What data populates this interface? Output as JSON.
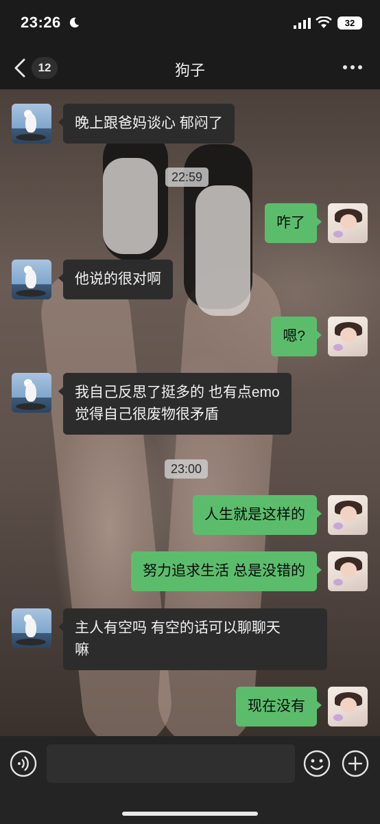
{
  "status_bar": {
    "time": "23:26",
    "battery": "32",
    "icons": [
      "moon-icon",
      "cellular-signal-icon",
      "wifi-icon",
      "battery-icon"
    ]
  },
  "nav": {
    "title": "狗子",
    "unread_count": "12",
    "icons": [
      "chevron-left-icon",
      "more-icon"
    ]
  },
  "messages": [
    {
      "type": "text",
      "from": "contact",
      "text": "晚上跟爸妈谈心 郁闷了"
    },
    {
      "type": "time",
      "text": "22:59"
    },
    {
      "type": "text",
      "from": "me",
      "text": "咋了"
    },
    {
      "type": "text",
      "from": "contact",
      "text": "他说的很对啊"
    },
    {
      "type": "text",
      "from": "me",
      "text": "嗯?"
    },
    {
      "type": "text",
      "from": "contact",
      "text": "我自己反思了挺多的 也有点emo\n觉得自己很废物很矛盾"
    },
    {
      "type": "time",
      "text": "23:00"
    },
    {
      "type": "text",
      "from": "me",
      "text": "人生就是这样的"
    },
    {
      "type": "text",
      "from": "me",
      "text": "努力追求生活 总是没错的"
    },
    {
      "type": "text",
      "from": "contact",
      "text": "主人有空吗 有空的话可以聊聊天\n嘛"
    },
    {
      "type": "text",
      "from": "me",
      "text": "现在没有"
    }
  ],
  "input_bar": {
    "placeholder": "",
    "icons": [
      "voice-icon",
      "emoji-icon",
      "plus-icon"
    ]
  },
  "colors": {
    "outgoing_bubble": "#5bbd6c",
    "incoming_bubble": "#2c2c2c",
    "bar_background": "#1b1b1b"
  }
}
